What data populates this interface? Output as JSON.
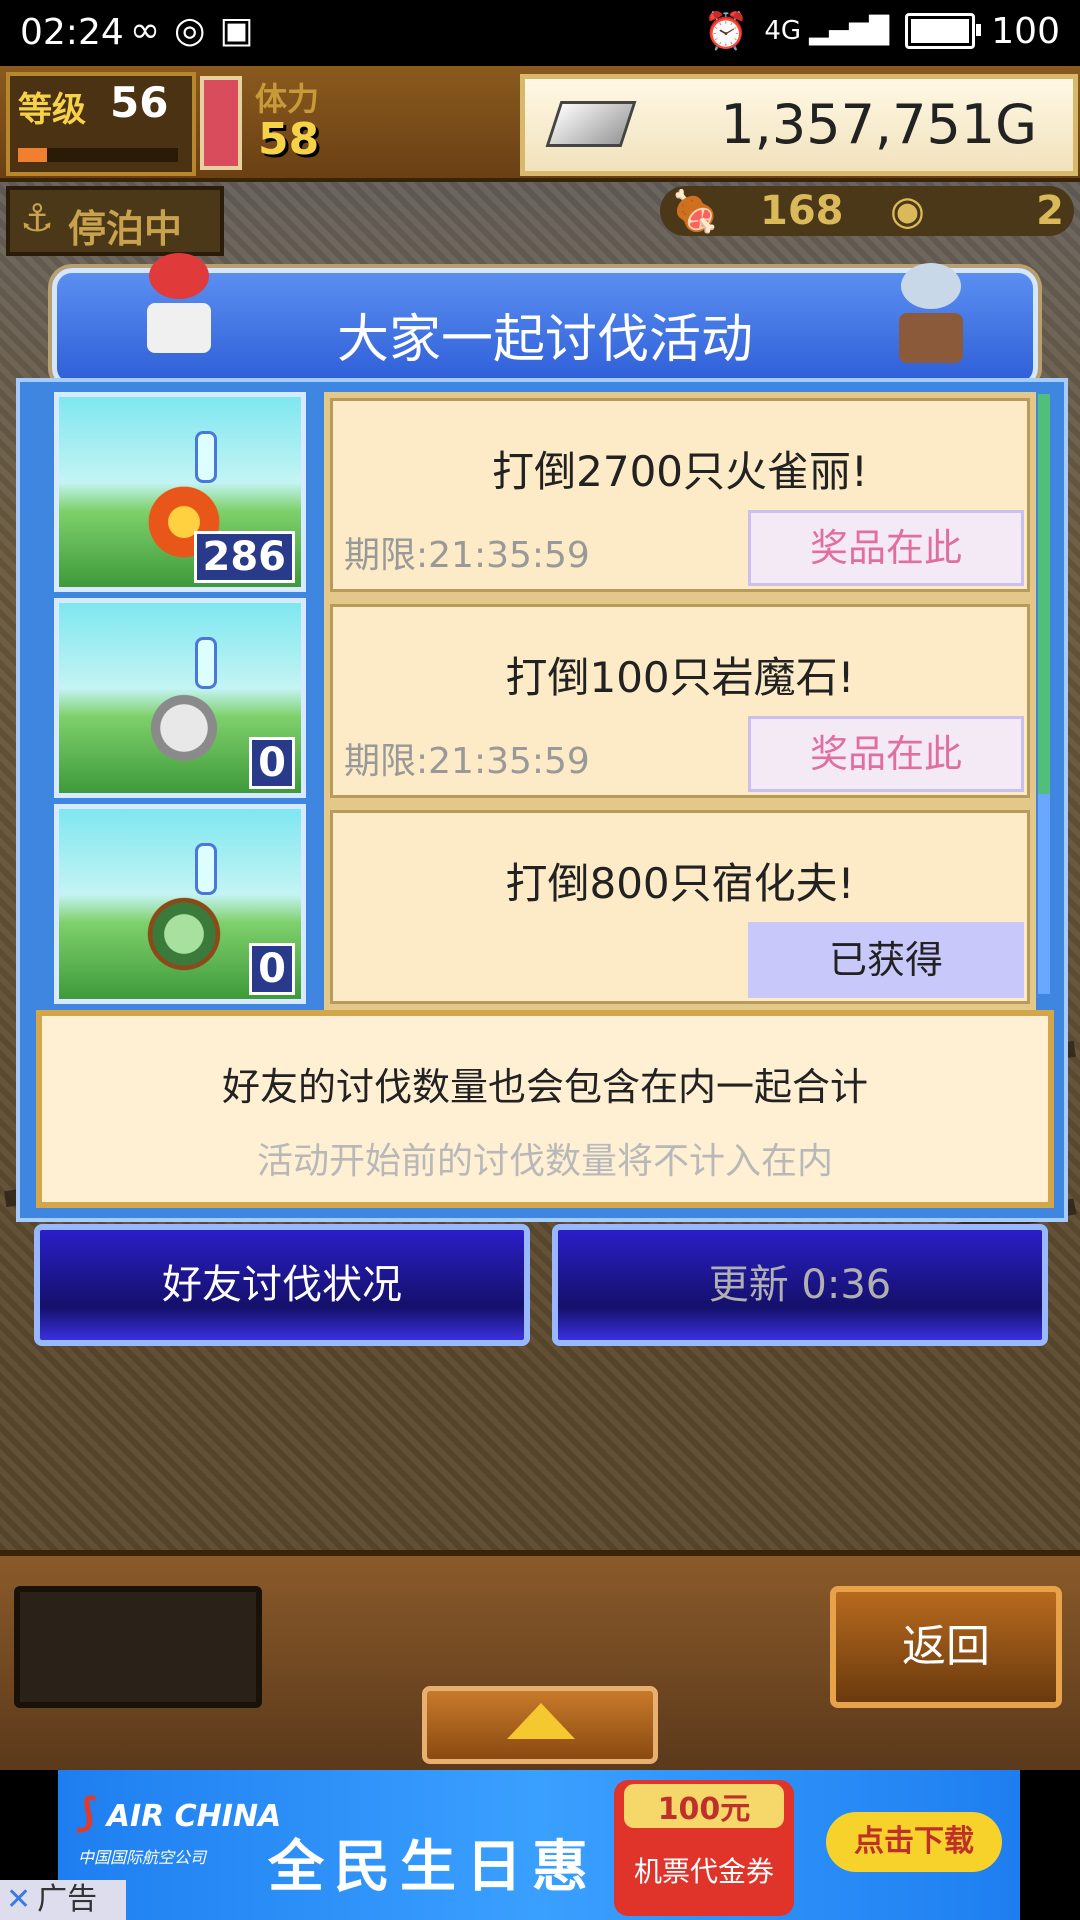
{
  "status_bar": {
    "time": "02:24",
    "network": "4G",
    "battery": "100"
  },
  "hud": {
    "level_label": "等级",
    "level": "56",
    "stamina_label": "体力",
    "stamina": "58",
    "gold": "1,357,751G",
    "dock_status": "停泊中",
    "resource_1": "168",
    "resource_2": "2"
  },
  "panel": {
    "title": "大家一起讨伐活动",
    "events": [
      {
        "quest": "打倒2700只火雀丽!",
        "deadline": "期限:21:35:59",
        "button": "奖品在此",
        "count": "286",
        "monster": "fire-bird"
      },
      {
        "quest": "打倒100只岩魔石!",
        "deadline": "期限:21:35:59",
        "button": "奖品在此",
        "count": "0",
        "monster": "rock-golem"
      },
      {
        "quest": "打倒800只宿化夫!",
        "deadline": "",
        "button": "已获得",
        "count": "0",
        "monster": "plant-creature"
      }
    ],
    "note_line1": "好友的讨伐数量也会包含在内一起合计",
    "note_line2": "活动开始前的讨伐数量将不计入在内"
  },
  "buttons": {
    "friend_status": "好友讨伐状况",
    "refresh": "更新 0:36",
    "back": "返回"
  },
  "ad": {
    "brand": "AIR CHINA",
    "brand_sub": "中国国际航空公司",
    "slogan": "全民生日惠",
    "coupon_top": "100元",
    "coupon_bottom": "机票代金券",
    "download": "点击下载",
    "tag": "广告"
  },
  "colors": {
    "panel_blue": "#3e86e0",
    "card_bg": "#fcebc6",
    "prize_text": "#e06fa0",
    "button_blue": "#14106a"
  }
}
